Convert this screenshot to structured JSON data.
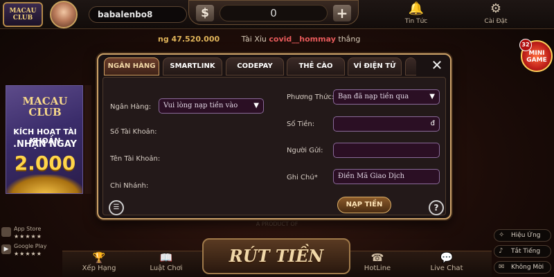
{
  "topbar": {
    "logo_top": "MACAU",
    "logo_bottom": "CLUB",
    "username": "babalenbo8",
    "balance": "0",
    "dollar_icon": "$",
    "plus_icon": "+",
    "news_label": "Tin Tức",
    "settings_label": "Cài Đặt"
  },
  "ticker": {
    "amount": "ng 47.520.000",
    "game": "Tài Xỉu",
    "user": "covid__hommay",
    "result": "thắng"
  },
  "promo": {
    "logo": "MACAU CLUB",
    "line1": "KÍCH HOẠT TÀI KHOẢN",
    "line2": ".NHẬN NGAY",
    "amount": "2.000"
  },
  "stores": {
    "app_store": "App Store",
    "google_play": "Google Play",
    "stars": "★★★★★"
  },
  "minigame": {
    "badge": "32",
    "label": "MINI GAME"
  },
  "toggles": {
    "effects": "Hiệu Ứng",
    "mute": "Tắt Tiếng",
    "no_invite": "Không Mời"
  },
  "bottom": {
    "rank": "Xếp Hạng",
    "rules": "Luật Chơi",
    "withdraw": "RÚT TIỀN",
    "hotline": "HotLine",
    "chat": "Live Chat",
    "product": "A PRODUCT OF"
  },
  "dialog": {
    "tabs": {
      "bank": "NGÂN HÀNG",
      "smartlink": "SMARTLINK",
      "codepay": "CODEPAY",
      "card": "THẺ CÀO",
      "wallet": "VÍ ĐIỆN TỬ"
    },
    "close": "✕",
    "left": {
      "bank_label": "Ngân Hàng:",
      "bank_select": "Vui lòng nạp tiền vào",
      "account_no_label": "Số Tài Khoản:",
      "account_name_label": "Tên Tài Khoản:",
      "branch_label": "Chi Nhánh:"
    },
    "right": {
      "method_label": "Phương Thức:",
      "method_select": "Bạn đã nạp tiền qua",
      "amount_label": "Số Tiền:",
      "amount_unit": "đ",
      "sender_label": "Người Gửi:",
      "note_label": "Ghi Chú*",
      "note_placeholder": "Điền Mã Giao Dịch"
    },
    "submit": "NẠP TIỀN",
    "help": "?"
  }
}
